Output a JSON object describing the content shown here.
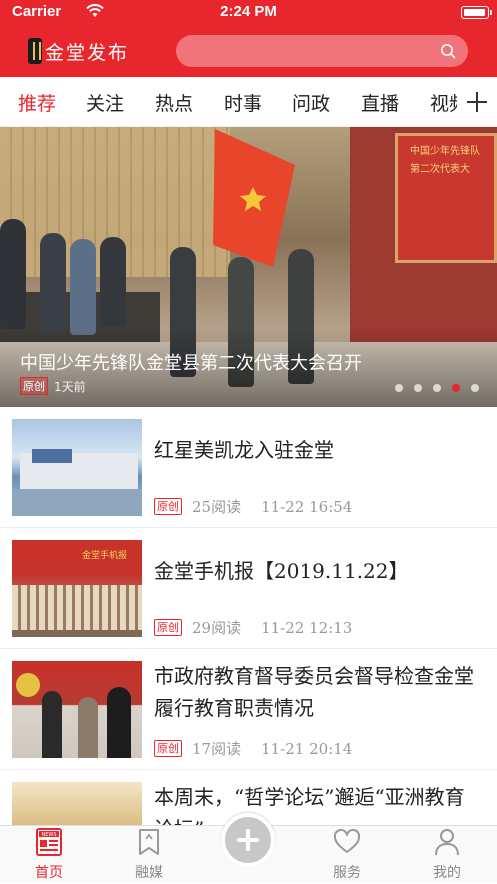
{
  "status_bar": {
    "carrier": "Carrier",
    "time": "2:24 PM"
  },
  "header": {
    "app_title": "金堂发布",
    "search_placeholder": ""
  },
  "tabs": [
    {
      "label": "推荐",
      "active": true
    },
    {
      "label": "关注"
    },
    {
      "label": "热点"
    },
    {
      "label": "时事"
    },
    {
      "label": "问政"
    },
    {
      "label": "直播"
    },
    {
      "label": "视频"
    }
  ],
  "banner": {
    "title": "中国少年先锋队金堂县第二次代表大会召开",
    "badge": "原创",
    "time": "1天前",
    "screen_text_line1": "中国少年先锋队",
    "screen_text_line2": "第二次代表大",
    "slide_count": 5,
    "active_slide": 4
  },
  "articles": [
    {
      "title": "红星美凯龙入驻金堂",
      "badge": "原创",
      "reads": "25阅读",
      "time": "11-22 16:54"
    },
    {
      "title": "金堂手机报【2019.11.22】",
      "badge": "原创",
      "reads": "29阅读",
      "time": "11-22 12:13",
      "thumb_text": "金堂手机报"
    },
    {
      "title": "市政府教育督导委员会督导检查金堂履行教育职责情况",
      "badge": "原创",
      "reads": "17阅读",
      "time": "11-21 20:14"
    },
    {
      "title": "本周末，“哲学论坛”邂逅“亚洲教育论坛”",
      "badge": "",
      "reads": "",
      "time": ""
    }
  ],
  "tab_bar": [
    {
      "label": "首页",
      "icon": "news-icon",
      "active": true
    },
    {
      "label": "融媒",
      "icon": "bookmark-icon"
    },
    {
      "label": "",
      "icon": "plus-icon"
    },
    {
      "label": "服务",
      "icon": "heart-icon"
    },
    {
      "label": "我的",
      "icon": "user-icon"
    }
  ],
  "colors": {
    "brand_red": "#e8262e",
    "text": "#222222",
    "muted": "#999999"
  }
}
